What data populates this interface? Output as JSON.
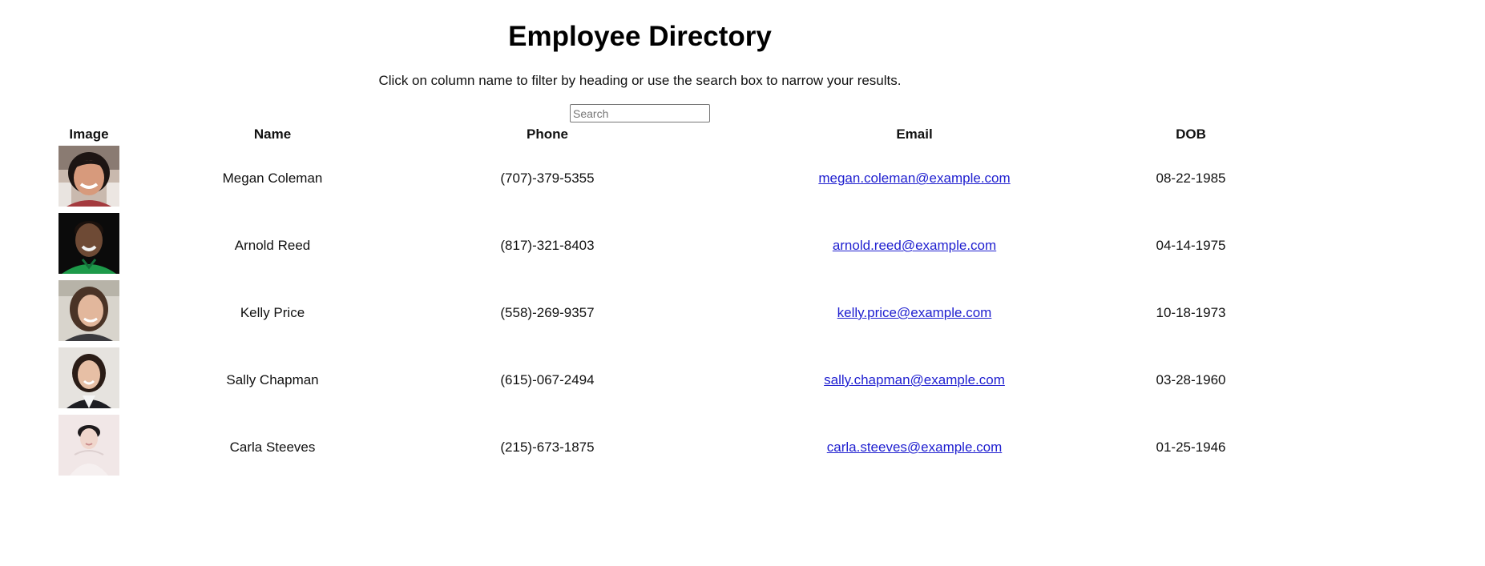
{
  "header": {
    "title": "Employee Directory",
    "subtitle": "Click on column name to filter by heading or use the search box to narrow your results."
  },
  "search": {
    "placeholder": "Search",
    "value": ""
  },
  "table": {
    "columns": [
      "Image",
      "Name",
      "Phone",
      "Email",
      "DOB"
    ],
    "rows": [
      {
        "name": "Megan Coleman",
        "phone": "(707)-379-5355",
        "email": "megan.coleman@example.com",
        "dob": "08-22-1985",
        "photo_icon": "employee-photo"
      },
      {
        "name": "Arnold Reed",
        "phone": "(817)-321-8403",
        "email": "arnold.reed@example.com",
        "dob": "04-14-1975",
        "photo_icon": "employee-photo"
      },
      {
        "name": "Kelly Price",
        "phone": "(558)-269-9357",
        "email": "kelly.price@example.com",
        "dob": "10-18-1973",
        "photo_icon": "employee-photo"
      },
      {
        "name": "Sally Chapman",
        "phone": "(615)-067-2494",
        "email": "sally.chapman@example.com",
        "dob": "03-28-1960",
        "photo_icon": "employee-photo"
      },
      {
        "name": "Carla Steeves",
        "phone": "(215)-673-1875",
        "email": "carla.steeves@example.com",
        "dob": "01-25-1946",
        "photo_icon": "employee-photo"
      }
    ]
  },
  "colors": {
    "link": "#2020d0",
    "text": "#111111",
    "background": "#ffffff"
  }
}
